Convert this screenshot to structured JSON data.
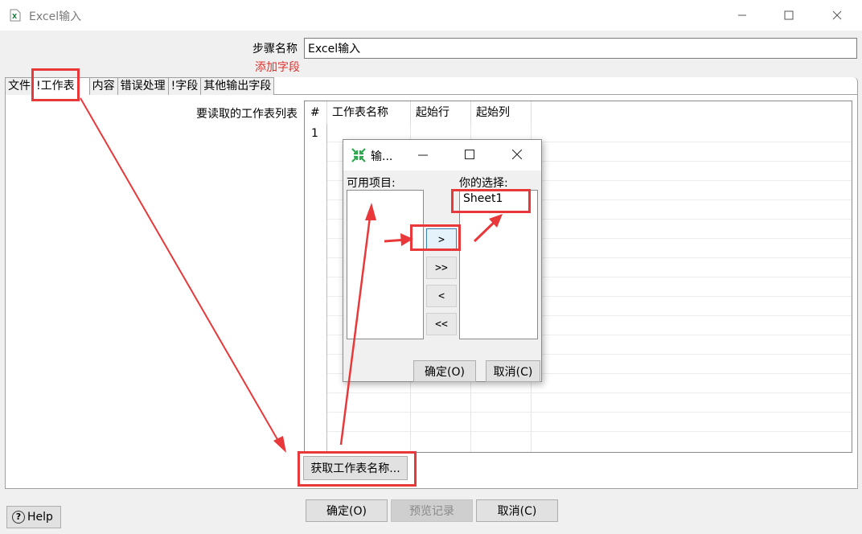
{
  "window": {
    "title": "Excel输入",
    "icon": "excel-file-icon"
  },
  "form": {
    "step_name_label": "步骤名称",
    "step_name_value": "Excel输入",
    "add_field_link": "添加字段"
  },
  "tabs": [
    {
      "label": "文件"
    },
    {
      "label": "!工作表"
    },
    {
      "label": "内容"
    },
    {
      "label": "错误处理"
    },
    {
      "label": "!字段"
    },
    {
      "label": "其他输出字段"
    }
  ],
  "sheets": {
    "list_label": "要读取的工作表列表",
    "columns": [
      "#",
      "工作表名称",
      "起始行",
      "起始列"
    ],
    "rows": [
      {
        "num": "1"
      }
    ],
    "get_names_button": "获取工作表名称..."
  },
  "dialog": {
    "title": "输...",
    "available_label": "可用项目:",
    "selected_label": "你的选择:",
    "selected_items": [
      "Sheet1"
    ],
    "move_buttons": [
      ">",
      ">>",
      "<",
      "<<"
    ],
    "ok": "确定(O)",
    "cancel": "取消(C)"
  },
  "footer": {
    "help": "Help",
    "ok": "确定(O)",
    "preview": "预览记录",
    "cancel": "取消(C)"
  },
  "colors": {
    "annotation": "#e8383a",
    "link_red": "#e0302a"
  }
}
